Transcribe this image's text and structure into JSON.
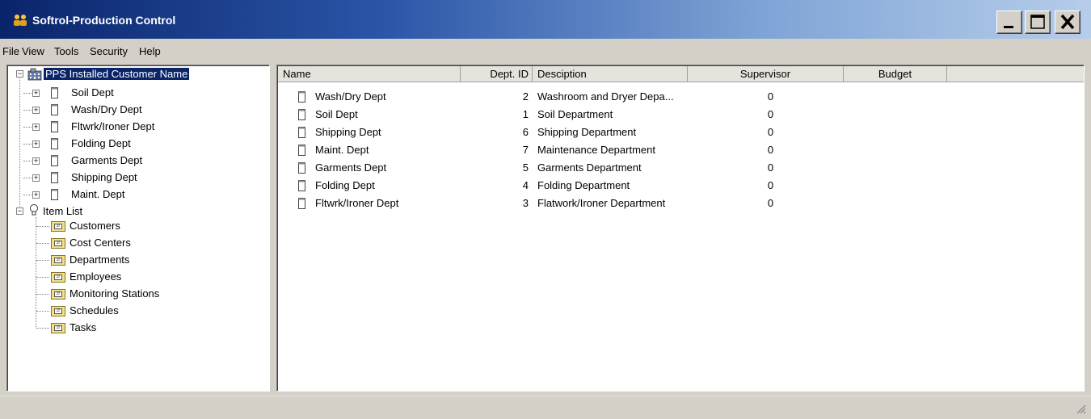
{
  "window": {
    "title": "Softrol-Production Control",
    "accent": "#0a246a",
    "icon": "people-icon",
    "buttons": {
      "minimize": "minimize-icon",
      "maximize": "maximize-icon",
      "close": "close-icon"
    }
  },
  "menu": [
    "File",
    "View",
    "Tools",
    "Security",
    "Help"
  ],
  "tree": {
    "root": "PPS Installed Customer Name",
    "departments": [
      "Soil Dept",
      "Wash/Dry Dept",
      "Fltwrk/Ironer Dept",
      "Folding Dept",
      "Garments Dept",
      "Shipping Dept",
      "Maint. Dept"
    ],
    "item_list": {
      "label": "Item List",
      "items": [
        "Customers",
        "Cost Centers",
        "Departments",
        "Employees",
        "Monitoring Stations",
        "Schedules",
        "Tasks"
      ]
    }
  },
  "list": {
    "columns": [
      "Name",
      "Dept. ID",
      "Desciption",
      "Supervisor",
      "Budget"
    ],
    "rows": [
      {
        "name": "Wash/Dry Dept",
        "id": "2",
        "desc": "Washroom and Dryer Depa...",
        "supervisor": "0"
      },
      {
        "name": "Soil Dept",
        "id": "1",
        "desc": "Soil Department",
        "supervisor": "0"
      },
      {
        "name": "Shipping Dept",
        "id": "6",
        "desc": "Shipping Department",
        "supervisor": "0"
      },
      {
        "name": "Maint. Dept",
        "id": "7",
        "desc": "Maintenance Department",
        "supervisor": "0"
      },
      {
        "name": "Garments Dept",
        "id": "5",
        "desc": "Garments Department",
        "supervisor": "0"
      },
      {
        "name": "Folding Dept",
        "id": "4",
        "desc": "Folding Department",
        "supervisor": "0"
      },
      {
        "name": "Fltwrk/Ironer Dept",
        "id": "3",
        "desc": "Flatwork/Ironer Department",
        "supervisor": "0"
      }
    ]
  }
}
